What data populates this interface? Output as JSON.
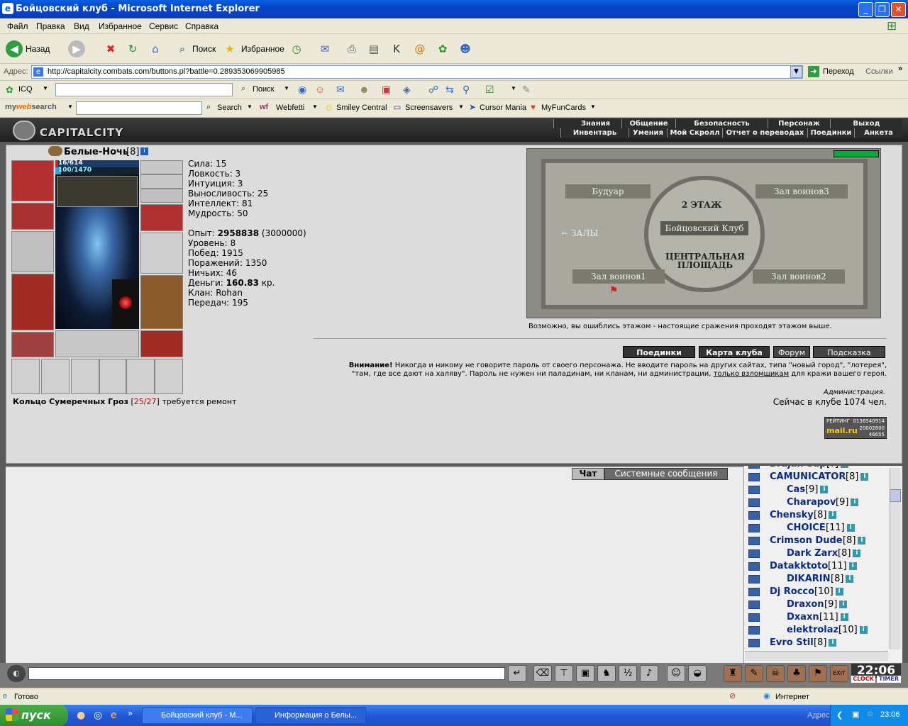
{
  "window": {
    "title": "Бойцовский клуб - Microsoft Internet Explorer"
  },
  "menu": [
    "Файл",
    "Правка",
    "Вид",
    "Избранное",
    "Сервис",
    "Справка"
  ],
  "toolbar": {
    "back": "Назад",
    "search": "Поиск",
    "favorites": "Избранное"
  },
  "address": {
    "label": "Адрес:",
    "url": "http://capitalcity.combats.com/buttons.pl?battle=0.289353069905985",
    "go": "Переход",
    "links": "Ссылки"
  },
  "icqbar": {
    "icq": "ICQ",
    "search": "Поиск"
  },
  "mws": {
    "brand_my": "my",
    "brand_web": "web",
    "brand_search": "search",
    "search": "Search",
    "webfetti": "Webfetti",
    "smiley": "Smiley Central",
    "screensavers": "Screensavers",
    "cursor": "Cursor Mania",
    "myfuncards": "MyFunCards"
  },
  "game": {
    "logo": "CAPITALCITY",
    "nav_top": [
      "Знания",
      "Общение",
      "Безопасность",
      "Персонаж",
      "Выход"
    ],
    "nav_bottom": [
      "Инвентарь",
      "Умения",
      "Мой Скролл",
      "Отчет о переводах",
      "Поединки",
      "Анкета"
    ],
    "char": {
      "name": "Белые-Ночь",
      "level": "[8]",
      "hp": "16/614",
      "mana": "100/1470"
    },
    "stats": [
      "Сила: 15",
      "Ловкость: 3",
      "Интуиция: 3",
      "Выносливость: 25",
      "Интеллект: 81",
      "Мудрость: 50"
    ],
    "exp_label": "Опыт:",
    "exp_value": "2958838",
    "exp_next": "(3000000)",
    "stats2": [
      "Уровень: 8",
      "Побед: 1915",
      "Поражений: 1350",
      "Ничьих: 46"
    ],
    "money_label": "Деньги:",
    "money_value": "160.83",
    "money_unit": "кр.",
    "stats3": [
      "Клан: Rohan",
      "Передач: 195"
    ],
    "item_name": "Кольцо Сумеречных Гроз",
    "item_dur": "25/27",
    "item_note": "требуется ремонт",
    "map": {
      "floor": "2 ЭТАЖ",
      "club": "Бойцовский Клуб",
      "boudoir": "Будуар",
      "halls": "ЗАЛЫ",
      "warriors3": "Зал воинов3",
      "warriors1": "Зал воинов1",
      "warriors2": "Зал воинов2",
      "central": "ЦЕНТРАЛЬНАЯ ПЛОЩАДЬ"
    },
    "map_note": "Возможно, вы ошиблись этажом - настоящие сражения проходят этажом выше.",
    "buttons": [
      "Поединки",
      "Карта клуба",
      "Форум",
      "Подсказка"
    ],
    "warning_bold": "Внимание!",
    "warning_text": "Никогда и никому не говорите пароль от своего персонажа. Не вводите пароль на других сайтах, типа \"новый город\", \"лотерея\", \"там, где все дают на халяву\". Пароль не нужен ни паладинам, ни кланам, ни администрации,",
    "warning_link": "только взломщикам",
    "warning_end": "для кражи вашего героя.",
    "admin": "Администрация.",
    "online": "Сейчас в клубе 1074 чел.",
    "counter_label": "РЕЙТИНГ",
    "counter_brand": "mail.ru",
    "counter_nums": [
      "0136540914",
      "20002800",
      "46655"
    ],
    "chat_tabs": [
      "Чат",
      "Системные сообщения"
    ],
    "users": [
      {
        "name": "Brajan Sap",
        "level": "[?]"
      },
      {
        "name": "CAMUNICATOR",
        "level": "[8]"
      },
      {
        "name": "Cas",
        "level": "[9]"
      },
      {
        "name": "Charapov",
        "level": "[9]"
      },
      {
        "name": "Chensky",
        "level": "[8]"
      },
      {
        "name": "CHOICE",
        "level": "[11]"
      },
      {
        "name": "Crimson Dude",
        "level": "[8]"
      },
      {
        "name": "Dark Zarx",
        "level": "[8]"
      },
      {
        "name": "Datakktoto",
        "level": "[11]"
      },
      {
        "name": "DIKARIN",
        "level": "[8]"
      },
      {
        "name": "Dj Rocco",
        "level": "[10]"
      },
      {
        "name": "Draxon",
        "level": "[9]"
      },
      {
        "name": "Dxaxn",
        "level": "[11]"
      },
      {
        "name": "elektrolaz",
        "level": "[10]"
      },
      {
        "name": "Evro Stil",
        "level": "[8]"
      }
    ],
    "clock": "22:06",
    "clock_label": "CLOCK",
    "timer_label": "TIMER"
  },
  "status": {
    "ready": "Готово",
    "zone": "Интернет"
  },
  "taskbar": {
    "start": "пуск",
    "tasks": [
      "Бойцовский клуб - М...",
      "Информация о Белы..."
    ],
    "addr": "Адрес:",
    "time": "23:06"
  }
}
